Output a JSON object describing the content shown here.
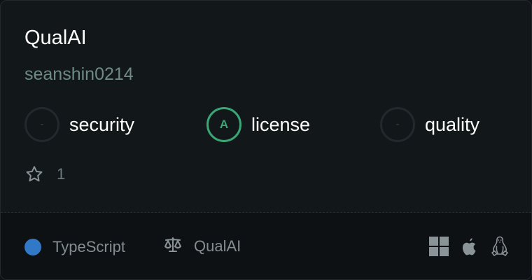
{
  "repo": {
    "name": "QualAI",
    "owner": "seanshin0214"
  },
  "scores": [
    {
      "label": "security",
      "grade": "-"
    },
    {
      "label": "license",
      "grade": "A"
    },
    {
      "label": "quality",
      "grade": "-"
    }
  ],
  "stars": {
    "icon": "star-icon",
    "count": "1"
  },
  "footer": {
    "language": "TypeScript",
    "language_color": "#3178c6",
    "license": "QualAI",
    "license_icon": "scale-icon",
    "platforms": [
      "windows-icon",
      "apple-icon",
      "linux-icon"
    ]
  },
  "colors": {
    "grade_a": "#3aa676",
    "background": "#121719"
  }
}
